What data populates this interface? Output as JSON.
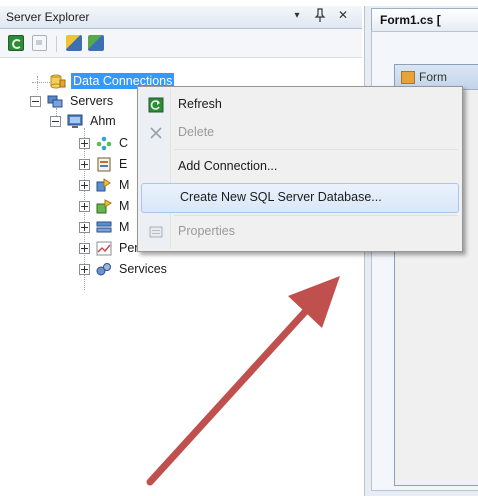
{
  "panel": {
    "title": "Server Explorer",
    "dropdown_glyph": "▾",
    "pin_glyph": "ᵃ",
    "close_glyph": "✕",
    "toolbar_icons": [
      "refresh-icon",
      "stop-icon",
      "connect-to-database-icon",
      "connect-to-server-icon"
    ]
  },
  "tree": {
    "data_connections": "Data Connections",
    "servers": "Servers",
    "machine": "Ahm",
    "children": [
      {
        "label": "C",
        "icon": "crystal-reports-icon"
      },
      {
        "label": "E",
        "icon": "event-logs-icon"
      },
      {
        "label": "M",
        "icon": "management-classes-icon"
      },
      {
        "label": "M",
        "icon": "management-events-icon"
      },
      {
        "label": "M",
        "icon": "message-queues-icon"
      },
      {
        "label": "Performance Counters",
        "icon": "performance-counters-icon"
      },
      {
        "label": "Services",
        "icon": "services-icon"
      }
    ]
  },
  "context_menu": {
    "items": [
      {
        "label": "Refresh",
        "icon": "refresh-icon",
        "enabled": true
      },
      {
        "label": "Delete",
        "icon": "delete-icon",
        "enabled": false
      },
      {
        "label": "Add Connection...",
        "icon": "",
        "enabled": true
      },
      {
        "label": "Create New SQL Server Database...",
        "icon": "",
        "enabled": true,
        "highlighted": true
      },
      {
        "label": "Properties",
        "icon": "properties-icon",
        "enabled": false
      }
    ]
  },
  "document": {
    "tab_label": "Form1.cs [",
    "form_caption": "Form"
  },
  "annotation": {
    "arrow_color": "#c0504d"
  },
  "colors": {
    "selection": "#3399ff",
    "arrow": "#c0504d"
  }
}
